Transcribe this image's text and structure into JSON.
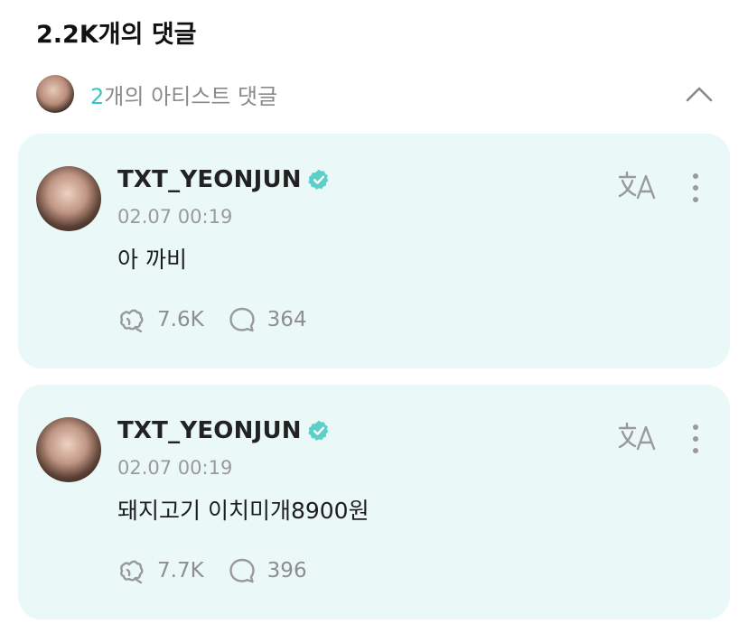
{
  "header": {
    "title": "2.2K개의 댓글"
  },
  "artist_section": {
    "count": "2",
    "label": "개의 아티스트 댓글",
    "collapse_icon": "chevron-up-icon"
  },
  "comments": [
    {
      "username": "TXT_YEONJUN",
      "verified": true,
      "timestamp": "02.07 00:19",
      "text": "아 까비",
      "likes": "7.6K",
      "replies": "364"
    },
    {
      "username": "TXT_YEONJUN",
      "verified": true,
      "timestamp": "02.07 00:19",
      "text": "돼지고기 이치미개8900원",
      "likes": "7.7K",
      "replies": "396"
    }
  ],
  "colors": {
    "card_bg": "#eaf9f7",
    "accent": "#41c4c0",
    "verified_badge": "#5ccfc9",
    "muted_text": "#9a9a9a"
  }
}
